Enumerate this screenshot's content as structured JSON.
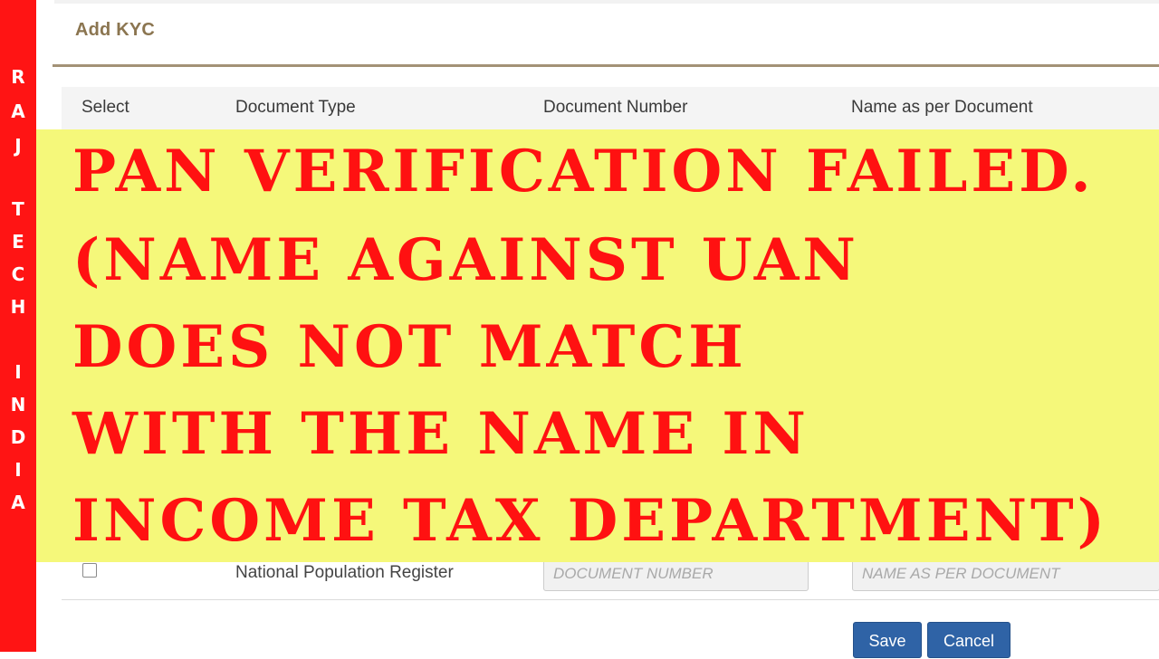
{
  "brand": {
    "letters": [
      "R",
      "A",
      "J",
      "T",
      "E",
      "C",
      "H",
      "I",
      "N",
      "D",
      "I",
      "A"
    ],
    "color": "#ff1414"
  },
  "panel": {
    "title": "Add KYC"
  },
  "table": {
    "headers": [
      "Select",
      "Document Type",
      "Document Number",
      "Name as per Document"
    ],
    "rows": [
      {
        "document_type": "National Population Register",
        "document_number_placeholder": "DOCUMENT NUMBER",
        "name_placeholder": "NAME AS PER DOCUMENT",
        "selected": false
      }
    ]
  },
  "buttons": {
    "save": "Save",
    "cancel": "Cancel"
  },
  "overlay": {
    "lines": [
      "PAN VERIFICATION FAILED.",
      "(NAME AGAINST UAN",
      "DOES NOT MATCH",
      "WITH THE NAME IN",
      "INCOME TAX DEPARTMENT)"
    ],
    "text_color": "#ff1111",
    "background": "#f5f87a"
  }
}
